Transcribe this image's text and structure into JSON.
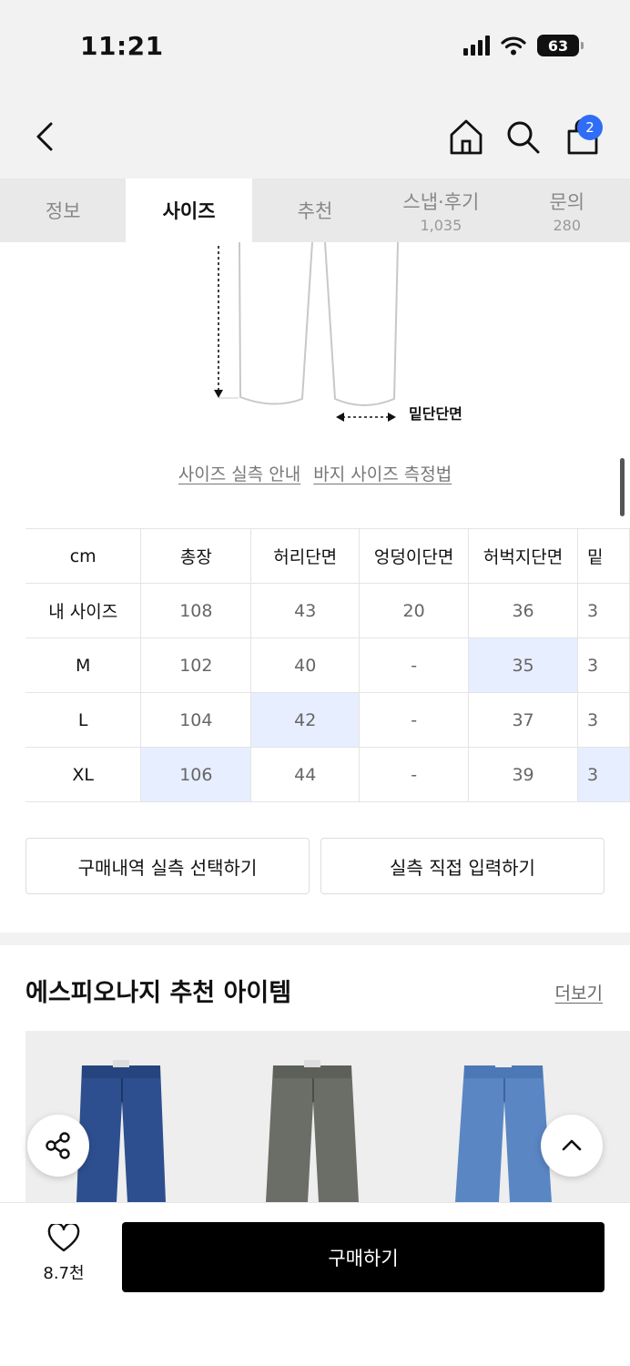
{
  "status": {
    "time": "11:21",
    "battery": "63"
  },
  "nav": {
    "cart_count": "2",
    "icons": [
      "back-icon",
      "home-icon",
      "search-icon",
      "cart-icon"
    ]
  },
  "tabs": [
    {
      "label": "정보",
      "sub": ""
    },
    {
      "label": "사이즈",
      "sub": "",
      "active": true
    },
    {
      "label": "추천",
      "sub": ""
    },
    {
      "label": "스냅·후기",
      "sub": "1,035"
    },
    {
      "label": "문의",
      "sub": "280"
    }
  ],
  "diagram": {
    "hem_label": "밑단단면"
  },
  "links": {
    "size_guide": "사이즈 실측 안내",
    "measure_method": "바지 사이즈 측정법"
  },
  "size_table": {
    "headers": [
      "cm",
      "총장",
      "허리단면",
      "엉덩이단면",
      "허벅지단면",
      "밑"
    ],
    "rows": [
      {
        "label": "내 사이즈",
        "cells": [
          "108",
          "43",
          "20",
          "36",
          "3"
        ]
      },
      {
        "label": "M",
        "cells": [
          "102",
          "40",
          "-",
          "35",
          "3"
        ]
      },
      {
        "label": "L",
        "cells": [
          "104",
          "42",
          "-",
          "37",
          "3"
        ]
      },
      {
        "label": "XL",
        "cells": [
          "106",
          "44",
          "-",
          "39",
          "3"
        ]
      }
    ],
    "highlight_color": "#e7eeff"
  },
  "buttons": {
    "purchase_history": "구매내역 실측 선택하기",
    "manual_input": "실측 직접 입력하기"
  },
  "recommend": {
    "title": "에스피오나지 추천 아이템",
    "more": "더보기"
  },
  "bottom": {
    "like_count": "8.7천",
    "buy": "구매하기"
  }
}
